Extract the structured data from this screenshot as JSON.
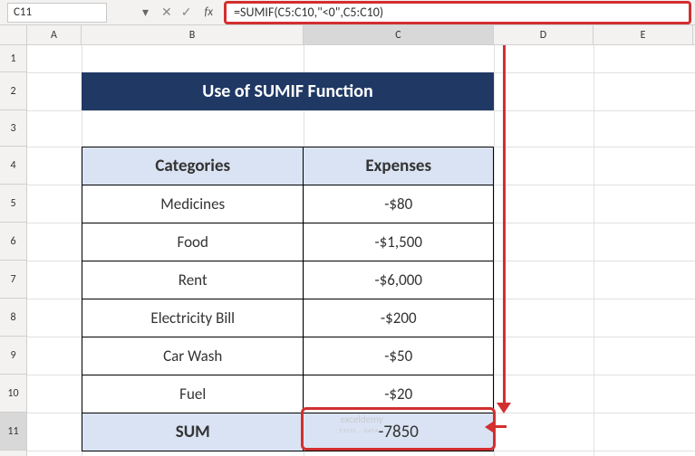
{
  "name_box": "C11",
  "formula": "=SUMIF(C5:C10,\"<0\",C5:C10)",
  "columns": [
    "A",
    "B",
    "C",
    "D",
    "E"
  ],
  "rows": [
    "1",
    "2",
    "3",
    "4",
    "5",
    "6",
    "7",
    "8",
    "9",
    "10",
    "11"
  ],
  "title": "Use of SUMIF Function",
  "headers": {
    "categories": "Categories",
    "expenses": "Expenses"
  },
  "items": [
    {
      "cat": "Medicines",
      "exp": "-$80"
    },
    {
      "cat": "Food",
      "exp": "-$1,500"
    },
    {
      "cat": "Rent",
      "exp": "-$6,000"
    },
    {
      "cat": "Electricity Bill",
      "exp": "-$200"
    },
    {
      "cat": "Car Wash",
      "exp": "-$50"
    },
    {
      "cat": "Fuel",
      "exp": "-$20"
    }
  ],
  "sum_label": "SUM",
  "sum_value": "-7850",
  "watermark_main": "exceldemy",
  "watermark_sub": "EXCEL · DATA ·",
  "chart_data": {
    "type": "table",
    "title": "Use of SUMIF Function",
    "columns": [
      "Categories",
      "Expenses"
    ],
    "rows": [
      [
        "Medicines",
        -80
      ],
      [
        "Food",
        -1500
      ],
      [
        "Rent",
        -6000
      ],
      [
        "Electricity Bill",
        -200
      ],
      [
        "Car Wash",
        -50
      ],
      [
        "Fuel",
        -20
      ]
    ],
    "sum": -7850,
    "formula": "=SUMIF(C5:C10,\"<0\",C5:C10)"
  }
}
